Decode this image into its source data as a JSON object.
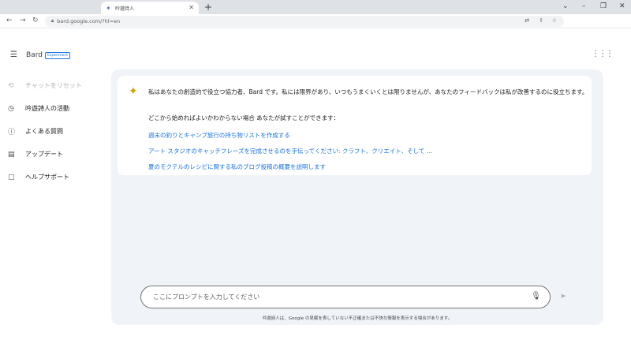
{
  "browser": {
    "tab_title": "吟遊詩人",
    "tab_icon": "bard-spark-icon",
    "url": "bard.google.com/?hl=en"
  },
  "header": {
    "brand": "Bard",
    "badge": "Experiment"
  },
  "sidebar": {
    "items": [
      {
        "label": "チャットをリセット",
        "icon": "reset-icon",
        "disabled": true
      },
      {
        "label": "吟遊詩人の活動",
        "icon": "history-icon",
        "disabled": false
      },
      {
        "label": "よくある質問",
        "icon": "help-icon",
        "disabled": false
      },
      {
        "label": "アップデート",
        "icon": "calendar-icon",
        "disabled": false
      },
      {
        "label": "ヘルプサポート",
        "icon": "feedback-icon",
        "disabled": false
      }
    ]
  },
  "chat": {
    "greeting": "私はあなたの創造的で役立つ協力者、Bard です。私には限界があり、いつもうまくいくとは限りませんが、あなたのフィードバックは私が改善するのに役立ちます。",
    "lead": "どこから始めればよいかわからない場合 あなたが試すことができます：",
    "suggestions": [
      "週末の釣りとキャンプ旅行の持ち物リストを作成する",
      "アート スタジオのキャッチフレーズを完成させるのを手伝ってください: クラフト、クリエイト、そして ...",
      "夏のモクテルのレシピに関する私のブログ投稿の概要を説明します"
    ]
  },
  "input": {
    "placeholder": "ここにプロンプトを入力してください"
  },
  "footer": {
    "disclaimer": "吟遊詩人は、Google の見解を表していない不正確または不快な情報を表示する場合があります。"
  },
  "colors": {
    "accent": "#1a73e8",
    "panel_bg": "#f0f4f9",
    "spark": "#d4a300"
  }
}
